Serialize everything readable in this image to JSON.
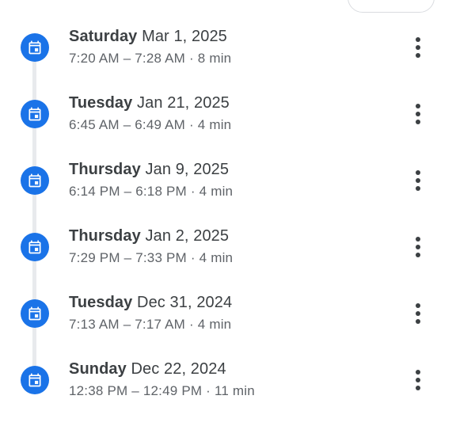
{
  "entries": [
    {
      "weekday": "Saturday",
      "date": "Mar 1, 2025",
      "time": "7:20 AM – 7:28 AM · 8 min",
      "icon": "event-icon"
    },
    {
      "weekday": "Tuesday",
      "date": "Jan 21, 2025",
      "time": "6:45 AM – 6:49 AM · 4 min",
      "icon": "event-icon"
    },
    {
      "weekday": "Thursday",
      "date": "Jan 9, 2025",
      "time": "6:14 PM – 6:18 PM · 4 min",
      "icon": "event-icon"
    },
    {
      "weekday": "Thursday",
      "date": "Jan 2, 2025",
      "time": "7:29 PM – 7:33 PM · 4 min",
      "icon": "event-icon"
    },
    {
      "weekday": "Tuesday",
      "date": "Dec 31, 2024",
      "time": "7:13 AM – 7:17 AM · 4 min",
      "icon": "event-icon"
    },
    {
      "weekday": "Sunday",
      "date": "Dec 22, 2024",
      "time": "12:38 PM – 12:49 PM · 11 min",
      "icon": "event-icon"
    }
  ],
  "colors": {
    "accent": "#1a73e8",
    "primary_text": "#3c4043",
    "secondary_text": "#5f6368",
    "timeline": "#e8eaed"
  }
}
